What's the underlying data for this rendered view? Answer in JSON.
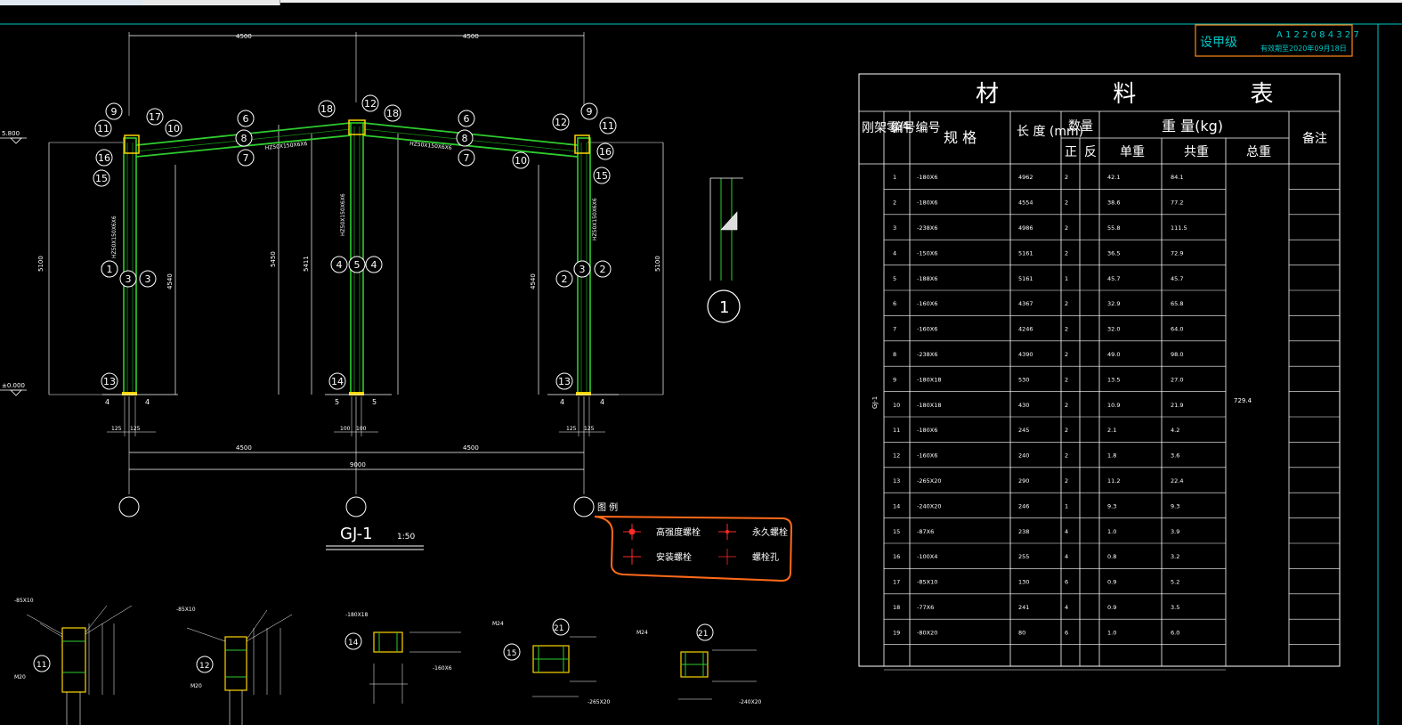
{
  "stamp": {
    "grade": "设甲级",
    "code": "A 1 2 2 0 8 4 3 2 7",
    "valid": "有效期至2020年09月18日"
  },
  "frame": {
    "title": "GJ-1",
    "scale": "1:50",
    "elev_top": "5.800",
    "elev_bottom": "±0.000",
    "dims_top": [
      "4500",
      "4500"
    ],
    "dims_bottom": [
      "4500",
      "4500"
    ],
    "dim_total": "9000",
    "dim_heights": [
      "5100",
      "4540",
      "5450",
      "5411",
      "4540",
      "5100"
    ],
    "members": [
      "HZ50X150X6X6",
      "HZ50X150X6X6",
      "HZ50X150X6X6",
      "HZ50X150X6X6",
      "HZ50X150X6X6"
    ],
    "base_dims": [
      "125",
      "125",
      "100",
      "100",
      "125",
      "125"
    ],
    "base_marks": [
      "4",
      "4",
      "5",
      "5",
      "4",
      "4"
    ],
    "part_nums": [
      "9",
      "11",
      "17",
      "10",
      "16",
      "15",
      "6",
      "8",
      "7",
      "18",
      "12",
      "18",
      "6",
      "8",
      "7",
      "12",
      "11",
      "9",
      "16",
      "10",
      "15",
      "1",
      "3",
      "2",
      "4",
      "5",
      "4",
      "2",
      "3",
      "1",
      "13",
      "14",
      "13",
      "3",
      "3"
    ],
    "section_mark": "1"
  },
  "legend": {
    "heading": "图 例",
    "items": [
      "高强度螺栓",
      "永久螺栓",
      "安装螺栓",
      "螺栓孔"
    ]
  },
  "table": {
    "title": "材 料 表",
    "headers": {
      "frame_no": "刚架 编号",
      "part_no": "零件 编号",
      "spec": "规 格",
      "length": "长 度 (mm)",
      "qty": "数量",
      "qty_pos": "正",
      "qty_neg": "反",
      "weight": "重 量(kg)",
      "unit": "单重",
      "sum": "共重",
      "total": "总重",
      "note": "备注"
    },
    "frame_id": "GJ-1",
    "total_weight": "729.4",
    "rows": [
      {
        "no": "1",
        "spec": "-180X6",
        "len": "4962",
        "qty": "2",
        "unit": "42.1",
        "sum": "84.1"
      },
      {
        "no": "2",
        "spec": "-180X6",
        "len": "4554",
        "qty": "2",
        "unit": "38.6",
        "sum": "77.2"
      },
      {
        "no": "3",
        "spec": "-238X6",
        "len": "4986",
        "qty": "2",
        "unit": "55.8",
        "sum": "111.5"
      },
      {
        "no": "4",
        "spec": "-150X6",
        "len": "5161",
        "qty": "2",
        "unit": "36.5",
        "sum": "72.9"
      },
      {
        "no": "5",
        "spec": "-188X6",
        "len": "5161",
        "qty": "1",
        "unit": "45.7",
        "sum": "45.7"
      },
      {
        "no": "6",
        "spec": "-160X6",
        "len": "4367",
        "qty": "2",
        "unit": "32.9",
        "sum": "65.8"
      },
      {
        "no": "7",
        "spec": "-160X6",
        "len": "4246",
        "qty": "2",
        "unit": "32.0",
        "sum": "64.0"
      },
      {
        "no": "8",
        "spec": "-238X6",
        "len": "4390",
        "qty": "2",
        "unit": "49.0",
        "sum": "98.0"
      },
      {
        "no": "9",
        "spec": "-180X18",
        "len": "530",
        "qty": "2",
        "unit": "13.5",
        "sum": "27.0"
      },
      {
        "no": "10",
        "spec": "-180X18",
        "len": "430",
        "qty": "2",
        "unit": "10.9",
        "sum": "21.9"
      },
      {
        "no": "11",
        "spec": "-180X6",
        "len": "245",
        "qty": "2",
        "unit": "2.1",
        "sum": "4.2"
      },
      {
        "no": "12",
        "spec": "-160X6",
        "len": "240",
        "qty": "2",
        "unit": "1.8",
        "sum": "3.6"
      },
      {
        "no": "13",
        "spec": "-265X20",
        "len": "290",
        "qty": "2",
        "unit": "11.2",
        "sum": "22.4"
      },
      {
        "no": "14",
        "spec": "-240X20",
        "len": "246",
        "qty": "1",
        "unit": "9.3",
        "sum": "9.3"
      },
      {
        "no": "15",
        "spec": "-87X6",
        "len": "238",
        "qty": "4",
        "unit": "1.0",
        "sum": "3.9"
      },
      {
        "no": "16",
        "spec": "-100X4",
        "len": "255",
        "qty": "4",
        "unit": "0.8",
        "sum": "3.2"
      },
      {
        "no": "17",
        "spec": "-85X10",
        "len": "130",
        "qty": "6",
        "unit": "0.9",
        "sum": "5.2"
      },
      {
        "no": "18",
        "spec": "-77X6",
        "len": "241",
        "qty": "4",
        "unit": "0.9",
        "sum": "3.5"
      },
      {
        "no": "19",
        "spec": "-80X20",
        "len": "80",
        "qty": "6",
        "unit": "1.0",
        "sum": "6.0"
      }
    ]
  },
  "details": {
    "labels": [
      "11",
      "12",
      "14",
      "15",
      "21",
      "21"
    ],
    "notes": [
      "-85X10",
      "M20",
      "-85X10",
      "M20",
      "-180X18",
      "M24",
      "-160X6",
      "M24",
      "-265X20",
      "M24",
      "-240X20"
    ]
  },
  "colors": {
    "frame": "#2ecc2e",
    "frame_dark": "#1a8f1a",
    "line": "#ffffff",
    "accent": "#ffd400",
    "orange": "#ff6a1a",
    "cyan": "#00c8c8",
    "red": "#ff2a2a"
  }
}
